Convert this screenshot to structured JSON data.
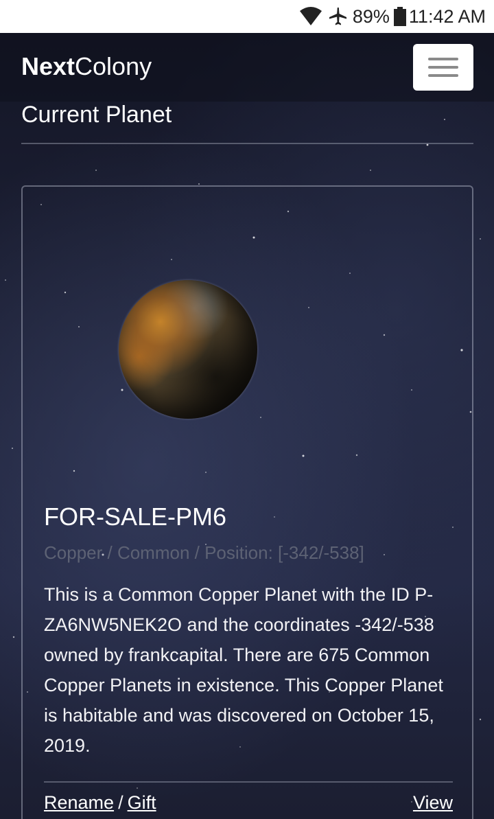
{
  "status_bar": {
    "battery_percent": "89%",
    "time": "11:42 AM",
    "icons": [
      "wifi-icon",
      "airplane-icon",
      "battery-icon"
    ]
  },
  "navbar": {
    "brand_bold": "Next",
    "brand_light": "Colony",
    "menu_icon": "hamburger-icon"
  },
  "page": {
    "section_title": "Current Planet"
  },
  "planet": {
    "name": "FOR-SALE-PM6",
    "meta": "Copper / Common / Position: [-342/-538]",
    "description": "This is a Common Copper Planet with the ID P-ZA6NW5NEK2O and the coordinates -342/-538 owned by frankcapital. There are 675 Common Copper Planets in existence. This Copper Planet is habitable and was discovered on October 15, 2019.",
    "actions": {
      "rename": "Rename",
      "separator": "/",
      "gift": "Gift",
      "view": "View"
    }
  },
  "colors": {
    "background": "#1e2238",
    "text": "#ffffff",
    "muted": "#5d6274",
    "planet_copper": "#c8862a"
  }
}
